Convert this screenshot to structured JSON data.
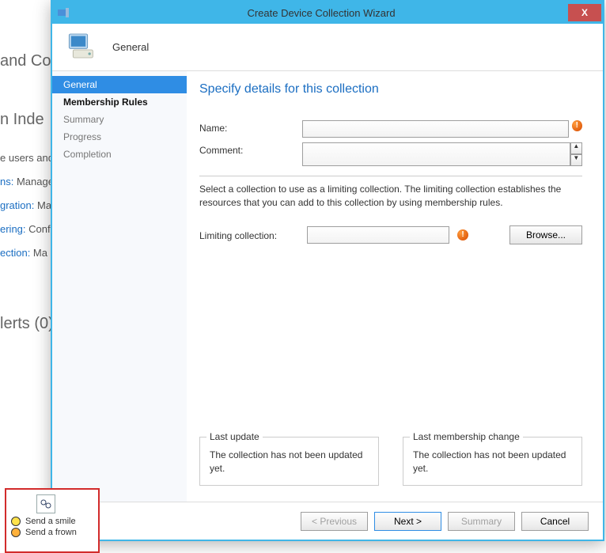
{
  "window": {
    "title": "Create Device Collection Wizard",
    "close_label": "X"
  },
  "header": {
    "title": "General"
  },
  "sidebar": {
    "items": [
      {
        "label": "General"
      },
      {
        "label": "Membership Rules"
      },
      {
        "label": "Summary"
      },
      {
        "label": "Progress"
      },
      {
        "label": "Completion"
      }
    ]
  },
  "content": {
    "heading": "Specify details for this collection",
    "name_label": "Name:",
    "name_value": "",
    "comment_label": "Comment:",
    "comment_value": "",
    "help_text": "Select a collection to use as a limiting collection. The limiting collection establishes the resources that you can add to this collection by using membership rules.",
    "limiting_label": "Limiting collection:",
    "limiting_value": "",
    "browse_label": "Browse...",
    "group_last_update": {
      "legend": "Last update",
      "text": "The collection has not been updated yet."
    },
    "group_last_membership": {
      "legend": "Last membership change",
      "text": "The collection has not been updated yet."
    }
  },
  "footer": {
    "previous": "< Previous",
    "next": "Next >",
    "summary": "Summary",
    "cancel": "Cancel"
  },
  "background": {
    "heading1": "and Co",
    "heading2": "n Inde",
    "line1": "e users and",
    "line2_a": "ns:",
    "line2_b": " Manage",
    "line3_a": "gration:",
    "line3_b": " Ma",
    "line4_a": "ering:",
    "line4_b": " Confi",
    "line5_a": "ection:",
    "line5_b": " Ma",
    "heading3": "lerts (0)"
  },
  "feedback": {
    "smile": "Send a smile",
    "frown": "Send a frown"
  }
}
